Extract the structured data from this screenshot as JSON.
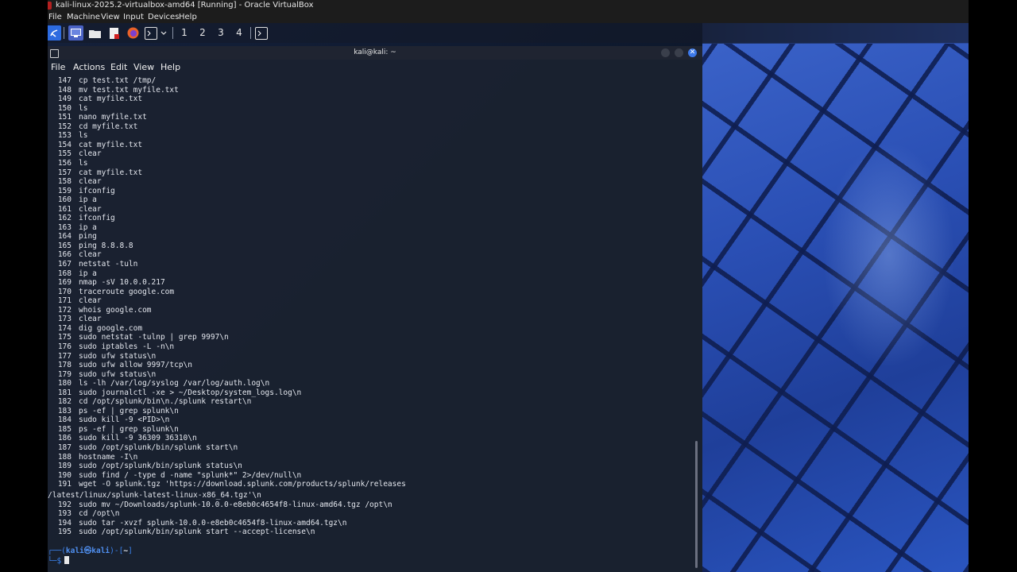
{
  "window": {
    "title": "kali-linux-2025.2-virtualbox-amd64 [Running] - Oracle VirtualBox"
  },
  "vbox_menu": [
    "File",
    "Machine",
    "View",
    "Input",
    "Devices",
    "Help"
  ],
  "panel": {
    "icons": [
      "kali-menu-icon",
      "desktop-icon",
      "file-manager-icon",
      "text-editor-icon",
      "firefox-icon",
      "terminal-launcher-icon",
      "chevron-down-icon"
    ],
    "workspaces": [
      "1",
      "2",
      "3",
      "4"
    ]
  },
  "terminal": {
    "title": "kali@kali: ~",
    "menu": [
      "File",
      "Actions",
      "Edit",
      "View",
      "Help"
    ],
    "history": [
      {
        "n": "147",
        "cmd": "cp test.txt /tmp/"
      },
      {
        "n": "148",
        "cmd": "mv test.txt myfile.txt"
      },
      {
        "n": "149",
        "cmd": "cat myfile.txt"
      },
      {
        "n": "150",
        "cmd": "ls"
      },
      {
        "n": "151",
        "cmd": "nano myfile.txt"
      },
      {
        "n": "152",
        "cmd": "cd myfile.txt"
      },
      {
        "n": "153",
        "cmd": "ls"
      },
      {
        "n": "154",
        "cmd": "cat myfile.txt"
      },
      {
        "n": "155",
        "cmd": "clear"
      },
      {
        "n": "156",
        "cmd": "ls"
      },
      {
        "n": "157",
        "cmd": "cat myfile.txt"
      },
      {
        "n": "158",
        "cmd": "clear"
      },
      {
        "n": "159",
        "cmd": "ifconfig"
      },
      {
        "n": "160",
        "cmd": "ip a"
      },
      {
        "n": "161",
        "cmd": "clear"
      },
      {
        "n": "162",
        "cmd": "ifconfig"
      },
      {
        "n": "163",
        "cmd": "ip a"
      },
      {
        "n": "164",
        "cmd": "ping"
      },
      {
        "n": "165",
        "cmd": "ping 8.8.8.8"
      },
      {
        "n": "166",
        "cmd": "clear"
      },
      {
        "n": "167",
        "cmd": "netstat -tuln"
      },
      {
        "n": "168",
        "cmd": "ip a"
      },
      {
        "n": "169",
        "cmd": "nmap -sV 10.0.0.217"
      },
      {
        "n": "170",
        "cmd": "traceroute google.com"
      },
      {
        "n": "171",
        "cmd": "clear"
      },
      {
        "n": "172",
        "cmd": "whois google.com"
      },
      {
        "n": "173",
        "cmd": "clear"
      },
      {
        "n": "174",
        "cmd": "dig google.com"
      },
      {
        "n": "175",
        "cmd": "sudo netstat -tulnp | grep 9997\\n"
      },
      {
        "n": "176",
        "cmd": "sudo iptables -L -n\\n"
      },
      {
        "n": "177",
        "cmd": "sudo ufw status\\n"
      },
      {
        "n": "178",
        "cmd": "sudo ufw allow 9997/tcp\\n"
      },
      {
        "n": "179",
        "cmd": "sudo ufw status\\n"
      },
      {
        "n": "180",
        "cmd": "ls -lh /var/log/syslog /var/log/auth.log\\n"
      },
      {
        "n": "181",
        "cmd": "sudo journalctl -xe > ~/Desktop/system_logs.log\\n"
      },
      {
        "n": "182",
        "cmd": "cd /opt/splunk/bin\\n./splunk restart\\n"
      },
      {
        "n": "183",
        "cmd": "ps -ef | grep splunk\\n"
      },
      {
        "n": "184",
        "cmd": "sudo kill -9 <PID>\\n"
      },
      {
        "n": "185",
        "cmd": "ps -ef | grep splunk\\n"
      },
      {
        "n": "186",
        "cmd": "sudo kill -9 36309 36310\\n"
      },
      {
        "n": "187",
        "cmd": "sudo /opt/splunk/bin/splunk start\\n"
      },
      {
        "n": "188",
        "cmd": "hostname -I\\n"
      },
      {
        "n": "189",
        "cmd": "sudo /opt/splunk/bin/splunk status\\n"
      },
      {
        "n": "190",
        "cmd": "sudo find / -type d -name \"splunk*\" 2>/dev/null\\n"
      },
      {
        "n": "191",
        "cmd": "wget -O splunk.tgz 'https://download.splunk.com/products/splunk/releases"
      }
    ],
    "wrap_191": "/latest/linux/splunk-latest-linux-x86_64.tgz'\\n",
    "history2": [
      {
        "n": "192",
        "cmd": "sudo mv ~/Downloads/splunk-10.0.0-e8eb0c4654f8-linux-amd64.tgz /opt\\n"
      },
      {
        "n": "193",
        "cmd": "cd /opt\\n"
      },
      {
        "n": "194",
        "cmd": "sudo tar -xvzf splunk-10.0.0-e8eb0c4654f8-linux-amd64.tgz\\n"
      },
      {
        "n": "195",
        "cmd": "sudo /opt/splunk/bin/splunk start --accept-license\\n"
      }
    ],
    "prompt": {
      "open": "┌──(",
      "user": "kali㉿kali",
      "mid": ")-[",
      "dir": "~",
      "close": "]",
      "line2": "└─$"
    }
  }
}
